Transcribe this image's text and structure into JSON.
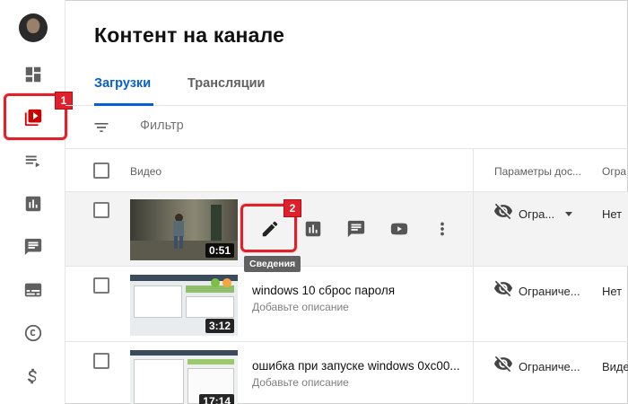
{
  "page_title": "Контент на канале",
  "tabs": [
    {
      "label": "Загрузки",
      "active": true
    },
    {
      "label": "Трансляции",
      "active": false
    }
  ],
  "filter": {
    "placeholder": "Фильтр"
  },
  "columns": {
    "video": "Видео",
    "visibility": "Параметры дос...",
    "restrictions": "Огра"
  },
  "sidebar": {
    "items": [
      {
        "icon": "dashboard-icon"
      },
      {
        "icon": "content-icon",
        "active": true
      },
      {
        "icon": "playlists-icon"
      },
      {
        "icon": "analytics-icon"
      },
      {
        "icon": "comments-icon"
      },
      {
        "icon": "subtitles-icon"
      },
      {
        "icon": "copyright-icon"
      },
      {
        "icon": "monetization-icon"
      }
    ]
  },
  "annotations": {
    "step1": "1",
    "step2": "2",
    "accent": "#e0202a"
  },
  "rows": [
    {
      "title": "",
      "description": "",
      "duration": "0:51",
      "visibility": "Огра...",
      "restrictions": "Нет",
      "tooltip": "Сведения"
    },
    {
      "title": "windows 10 сброс пароля",
      "description": "Добавьте описание",
      "duration": "3:12",
      "visibility": "Ограниче...",
      "restrictions": "Нет"
    },
    {
      "title": "ошибка при запуске windows 0xc00...",
      "description": "Добавьте описание",
      "duration": "17:14",
      "visibility": "Ограниче...",
      "restrictions": "Виде"
    }
  ]
}
